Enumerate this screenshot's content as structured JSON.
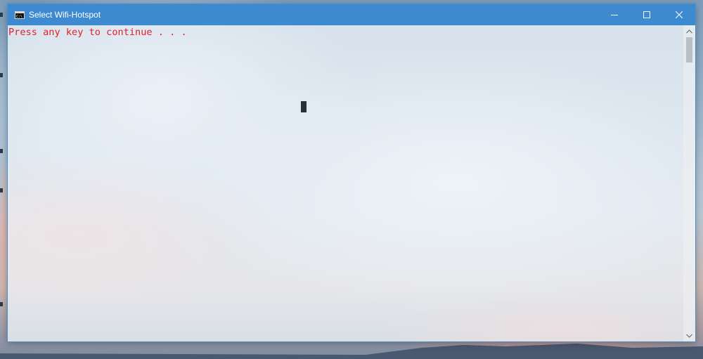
{
  "window": {
    "title": "Select Wifi-Hotspot",
    "icon": "console-icon",
    "titlebar_color": "#3d8ad0"
  },
  "caption_buttons": {
    "minimize": "minimize-icon",
    "maximize": "maximize-icon",
    "close": "close-icon"
  },
  "console": {
    "text": "Press any key to continue . . .",
    "text_color": "#e3202a"
  },
  "scrollbar": {
    "up": "scroll-up-arrow-icon",
    "down": "scroll-down-arrow-icon"
  }
}
